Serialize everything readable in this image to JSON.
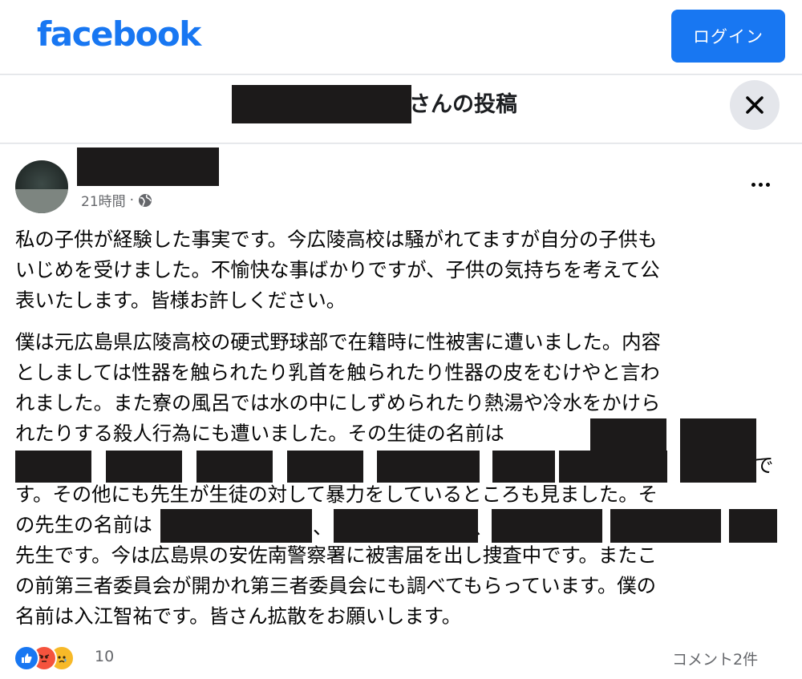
{
  "topbar": {
    "logo_text": "facebook",
    "login_label": "ログイン",
    "brand_color": "#1877f2"
  },
  "post_header": {
    "title_suffix": "さんの投稿",
    "close_icon": "close-icon"
  },
  "post": {
    "timestamp": "21時間",
    "separator": "·",
    "privacy_icon": "globe-icon",
    "paragraph1": [
      "私の子供が経験した事実です。今広陵高校は騒がれてますが自分の子供も",
      "いじめを受けました。不愉快な事ばかりですが、子供の気持ちを考えて公",
      "表いたします。皆様お許しください。"
    ],
    "paragraph2": [
      "僕は元広島県広陵高校の硬式野球部で在籍時に性被害に遭いました。内容",
      "としましては性器を触られたり乳首を触られたり性器の皮をむけやと言わ",
      "れました。また寮の風呂では水の中にしずめられたり熱湯や冷水をかけら",
      "れたりする殺人行為にも遭いました。その生徒の名前は",
      "、　　　、　　　、　　　、　　　、",
      "す。その他にも先生が生徒の対して暴力をしているところも見ました。そ",
      "の先生の名前は",
      "先生です。今は広島県の安佐南警察署に被害届を出し捜査中です。またこ",
      "の前第三者委員会が開かれ第三者委員会にも調べてもらっています。僕の",
      "名前は入江智祐です。皆さん拡散をお願いします。"
    ],
    "line5_end": "で",
    "line7_sep": "、"
  },
  "footer": {
    "reaction_icons": [
      "like-icon",
      "angry-icon",
      "sad-icon"
    ],
    "reaction_count": "10",
    "comments_label": "コメント2件"
  }
}
